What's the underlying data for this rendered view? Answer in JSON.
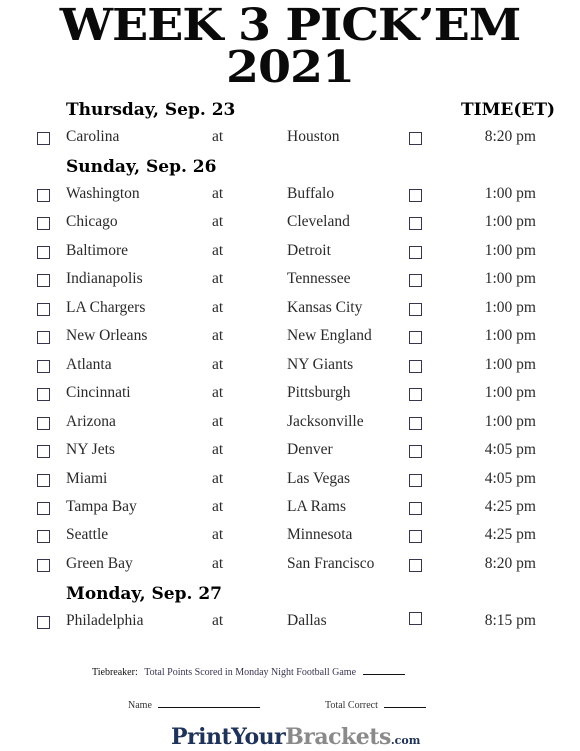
{
  "title": {
    "line1": "WEEK 3 PICK’EM",
    "line2": "2021"
  },
  "time_header": "TIME(ET)",
  "days": [
    {
      "label": "Thursday, Sep. 23",
      "games": [
        {
          "away": "Carolina",
          "sep": "at",
          "home": "Houston",
          "time": "8:20 pm"
        }
      ]
    },
    {
      "label": "Sunday, Sep. 26",
      "games": [
        {
          "away": "Washington",
          "sep": "at",
          "home": "Buffalo",
          "time": "1:00 pm"
        },
        {
          "away": "Chicago",
          "sep": "at",
          "home": "Cleveland",
          "time": "1:00 pm"
        },
        {
          "away": "Baltimore",
          "sep": "at",
          "home": "Detroit",
          "time": "1:00 pm"
        },
        {
          "away": "Indianapolis",
          "sep": "at",
          "home": "Tennessee",
          "time": "1:00 pm"
        },
        {
          "away": "LA Chargers",
          "sep": "at",
          "home": "Kansas City",
          "time": "1:00 pm"
        },
        {
          "away": "New Orleans",
          "sep": "at",
          "home": "New England",
          "time": "1:00 pm"
        },
        {
          "away": "Atlanta",
          "sep": "at",
          "home": "NY Giants",
          "time": "1:00 pm"
        },
        {
          "away": "Cincinnati",
          "sep": "at",
          "home": "Pittsburgh",
          "time": "1:00 pm"
        },
        {
          "away": "Arizona",
          "sep": "at",
          "home": "Jacksonville",
          "time": "1:00 pm"
        },
        {
          "away": "NY Jets",
          "sep": "at",
          "home": "Denver",
          "time": "4:05 pm"
        },
        {
          "away": "Miami",
          "sep": "at",
          "home": "Las Vegas",
          "time": "4:05 pm"
        },
        {
          "away": "Tampa Bay",
          "sep": "at",
          "home": "LA Rams",
          "time": "4:25 pm"
        },
        {
          "away": "Seattle",
          "sep": "at",
          "home": "Minnesota",
          "time": "4:25 pm"
        },
        {
          "away": "Green Bay",
          "sep": "at",
          "home": "San Francisco",
          "time": "8:20 pm"
        }
      ]
    },
    {
      "label": "Monday, Sep. 27",
      "games": [
        {
          "away": "Philadelphia",
          "sep": "at",
          "home": "Dallas",
          "time": "8:15 pm"
        }
      ]
    }
  ],
  "footer": {
    "tiebreaker_label": "Tiebreaker:",
    "tiebreaker_text": "Total Points Scored in Monday Night Football Game",
    "name_label": "Name",
    "total_correct_label": "Total Correct"
  },
  "logo": {
    "part1": "PrintYour",
    "part2": "Brackets",
    "part3": ".com",
    "colors": {
      "primary": "#1f3358",
      "secondary": "#8a8a8a"
    }
  }
}
